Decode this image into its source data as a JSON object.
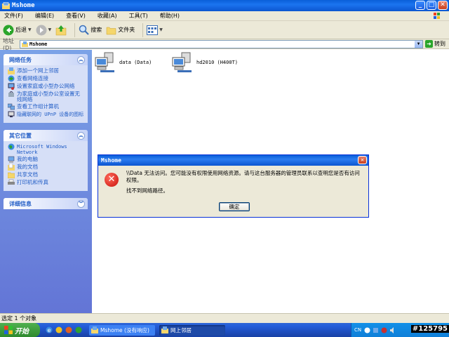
{
  "window": {
    "title": "Mshome",
    "btn_min": "_",
    "btn_max": "□",
    "btn_close": "✕"
  },
  "menu": {
    "items": [
      "文件(F)",
      "编辑(E)",
      "查看(V)",
      "收藏(A)",
      "工具(T)",
      "帮助(H)"
    ]
  },
  "toolbar": {
    "back": "后退",
    "search": "搜索",
    "folders": "文件夹"
  },
  "address": {
    "label": "地址(D)",
    "value": "Mshome",
    "go": "转到"
  },
  "left_pane": {
    "network_tasks": {
      "title": "网络任务",
      "links": [
        "添加一个网上邻居",
        "查看网络连接",
        "设置家庭或小型办公网络",
        "为家庭或小型办公室设置无线网络",
        "查看工作组计算机",
        "隐藏联网的 UPnP 设备的图标"
      ]
    },
    "other_places": {
      "title": "其它位置",
      "links": [
        "Microsoft Windows Network",
        "我的电脑",
        "我的文档",
        "共享文档",
        "打印机和传真"
      ]
    },
    "details": {
      "title": "详细信息"
    }
  },
  "content": {
    "items": [
      {
        "label": "data (Data)"
      },
      {
        "label": "hd2010 (H400T)"
      }
    ]
  },
  "dialog": {
    "title": "Mshome",
    "message": "\\\\Data 无法访问。您可能没有权限使用网络资源。请与这台服务器的管理员联系以查明您是否有访问权限。",
    "detail": "找不到网络路径。",
    "ok": "确定"
  },
  "status": {
    "text": "选定 1 个对象"
  },
  "taskbar": {
    "start": "开始",
    "tasks": [
      "Mshome (没有响应)",
      "网上邻居"
    ],
    "lang": "CN",
    "clock": "#125795"
  }
}
